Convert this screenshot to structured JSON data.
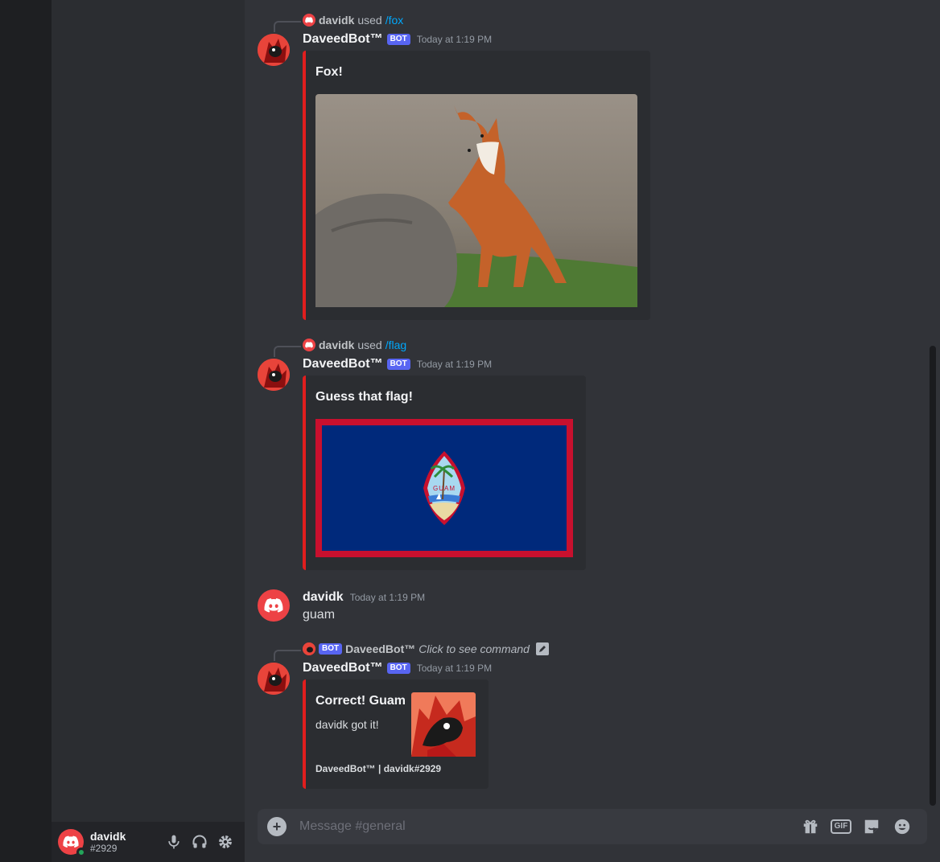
{
  "user": {
    "name": "davidk",
    "tag": "#2929"
  },
  "messages": {
    "fox": {
      "reply_user": "davidk",
      "reply_used": "used",
      "reply_cmd": "/fox",
      "author": "DaveedBot™",
      "badge": "BOT",
      "time": "Today at 1:19 PM",
      "embed_title": "Fox!"
    },
    "flag": {
      "reply_user": "davidk",
      "reply_used": "used",
      "reply_cmd": "/flag",
      "author": "DaveedBot™",
      "badge": "BOT",
      "time": "Today at 1:19 PM",
      "embed_title": "Guess that flag!",
      "flag_text": "GUAM"
    },
    "guess": {
      "author": "davidk",
      "time": "Today at 1:19 PM",
      "content": "guam"
    },
    "result": {
      "reply_badge": "BOT",
      "reply_author": "DaveedBot™",
      "reply_action": "Click to see command",
      "author": "DaveedBot™",
      "badge": "BOT",
      "time": "Today at 1:19 PM",
      "embed_title": "Correct! Guam",
      "embed_desc": "davidk got it!",
      "embed_footer": "DaveedBot™ | davidk#2929"
    }
  },
  "composer": {
    "placeholder": "Message #general"
  },
  "colors": {
    "embed_accent": "#e01e1e",
    "bot_badge": "#5865f2",
    "link": "#00a8fc",
    "online": "#23a55a"
  },
  "icons": [
    "plus-circle-icon",
    "gift-icon",
    "gif-icon",
    "sticker-icon",
    "emoji-icon",
    "microphone-icon",
    "headphones-icon",
    "gear-icon",
    "discord-logo-icon",
    "edit-icon"
  ]
}
